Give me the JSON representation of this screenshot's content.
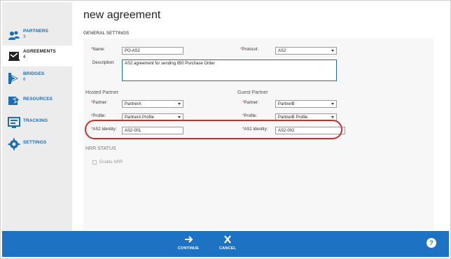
{
  "sidebar": {
    "items": [
      {
        "label": "PARTNERS",
        "count": "3",
        "icon": "partners-icon"
      },
      {
        "label": "AGREEMENTS",
        "count": "4",
        "icon": "agreements-icon",
        "active": true
      },
      {
        "label": "BRIDGES",
        "count": "6",
        "icon": "bridges-icon"
      },
      {
        "label": "RESOURCES",
        "count": "",
        "icon": "resources-icon"
      },
      {
        "label": "TRACKING",
        "count": "",
        "icon": "tracking-icon"
      },
      {
        "label": "SETTINGS",
        "count": "",
        "icon": "settings-icon"
      }
    ]
  },
  "page": {
    "title": "new agreement",
    "section_title": "GENERAL SETTINGS"
  },
  "form": {
    "required_mark": "*",
    "name_label": "Name:",
    "name_value": "PO-AS2",
    "protocol_label": "Protocol:",
    "protocol_value": "AS2",
    "description_label": "Description:",
    "description_value": "AS2 agreement for sending 850 Purchase Order",
    "hosted": {
      "title": "Hosted Partner",
      "partner_label": "Partner:",
      "partner_value": "PartnerA",
      "profile_label": "Profile:",
      "profile_value": "PartnerA Profile",
      "identity_label": "AS2 Identity:",
      "identity_value": "AS2-001"
    },
    "guest": {
      "title": "Guest Partner",
      "partner_label": "Partner:",
      "partner_value": "PartnerB",
      "profile_label": "Profile:",
      "profile_value": "PartnerB Profile",
      "identity_label": "AS2 Identity:",
      "identity_value": "AS2-002"
    },
    "nrr": {
      "title": "NRR STATUS",
      "enable_label": "Enable NRR",
      "enabled": false
    }
  },
  "footer": {
    "continue_label": "CONTINUE",
    "cancel_label": "CANCEL",
    "help_label": "?"
  },
  "colors": {
    "accent": "#1d72c4",
    "required": "#d9261c",
    "highlight": "#c9302c"
  }
}
